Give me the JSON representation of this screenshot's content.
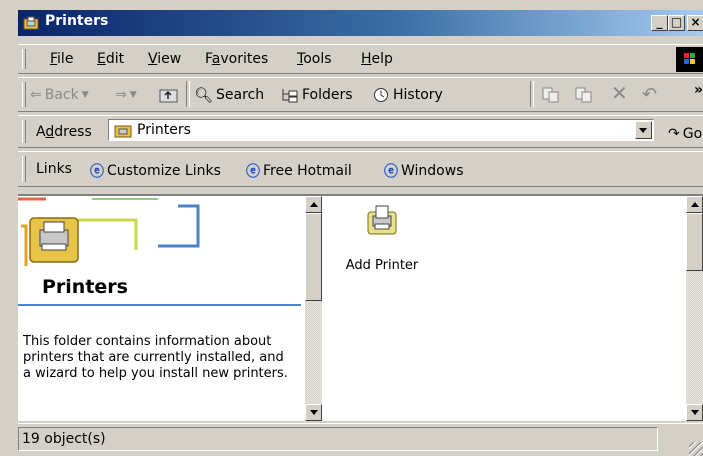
{
  "window": {
    "title": "Printers"
  },
  "menu": {
    "items": [
      {
        "pre": "",
        "ul": "F",
        "post": "ile"
      },
      {
        "pre": "",
        "ul": "E",
        "post": "dit"
      },
      {
        "pre": "",
        "ul": "V",
        "post": "iew"
      },
      {
        "pre": "F",
        "ul": "a",
        "post": "vorites"
      },
      {
        "pre": "",
        "ul": "T",
        "post": "ools"
      },
      {
        "pre": "",
        "ul": "H",
        "post": "elp"
      }
    ]
  },
  "toolbar": {
    "back": "Back",
    "search": "Search",
    "folders": "Folders",
    "history": "History",
    "more": "»"
  },
  "address": {
    "label_pre": "A",
    "label_ul": "d",
    "label_post": "dress",
    "value": "Printers",
    "go": "Go"
  },
  "links": {
    "label": "Links",
    "items": [
      "Customize Links",
      "Free Hotmail",
      "Windows"
    ]
  },
  "left_pane": {
    "heading": "Printers",
    "description": "This folder contains information about printers that are currently installed, and a wizard to help you install new printers."
  },
  "items": [
    {
      "label": "Add Printer"
    }
  ],
  "status": {
    "text": "19 object(s)"
  },
  "colors": {
    "title_start": "#0a246a",
    "title_end": "#a6caf0",
    "accent_line": "#4b84c8"
  }
}
